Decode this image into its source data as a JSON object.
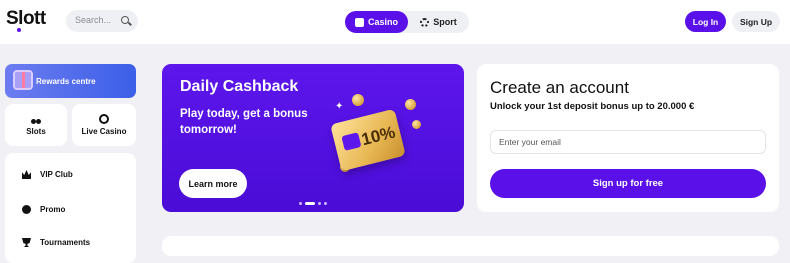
{
  "header": {
    "logo": "Slott",
    "search_placeholder": "Search...",
    "tabs": [
      {
        "label": "Casino",
        "active": true
      },
      {
        "label": "Sport",
        "active": false
      }
    ],
    "login_label": "Log In",
    "signup_label": "Sign Up"
  },
  "sidebar": {
    "rewards_label": "Rewards centre",
    "tiles": [
      {
        "label": "Slots",
        "icon": "cherry-icon"
      },
      {
        "label": "Live Casino",
        "icon": "roulette-icon"
      }
    ],
    "menu": [
      {
        "label": "VIP Club",
        "icon": "crown-icon"
      },
      {
        "label": "Promo",
        "icon": "promo-icon"
      },
      {
        "label": "Tournaments",
        "icon": "trophy-icon"
      }
    ]
  },
  "banner": {
    "title": "Daily Cashback",
    "subtitle": "Play today, get a bonus tomorrow!",
    "cta": "Learn more",
    "card_value": "10%",
    "slides": 4,
    "active_slide": 1
  },
  "account": {
    "title": "Create an account",
    "subtitle": "Unlock your 1st deposit bonus up to 20.000 €",
    "email_placeholder": "Enter your email",
    "submit": "Sign up for free"
  },
  "colors": {
    "accent": "#5a10e8",
    "rewards": "#4a67ec",
    "background": "#f1f1f5"
  }
}
